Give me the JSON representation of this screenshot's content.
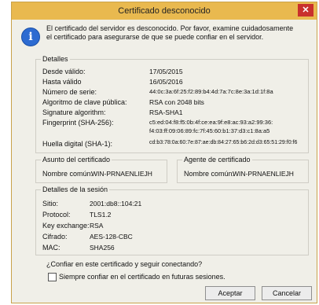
{
  "window": {
    "title": "Certificado desconocido",
    "close_symbol": "✕"
  },
  "intro_text": "El certificado del servidor es desconocido. Por favor, examine cuidadosamente el certificado para asegurarse de que se puede confiar en el servidor.",
  "details": {
    "title": "Detalles",
    "rows": [
      {
        "label": "Desde válido:",
        "value": "17/05/2015"
      },
      {
        "label": "Hasta válido",
        "value": "16/05/2016"
      },
      {
        "label": "Número de serie:",
        "value": "44:0c:3a:6f:25:f2:89:b4:4d:7a:7c:8e:3a:1d:1f:8a"
      },
      {
        "label": "Algoritmo de clave pública:",
        "value": "RSA con 2048 bits"
      },
      {
        "label": "Signature algorithm:",
        "value": "RSA-SHA1"
      },
      {
        "label": "Fingerprint (SHA-256):",
        "value": "c5:ed:04:f8:f5:0b:4f:ce:ea:9f:e8:ac:93:a2:99:36:",
        "value2": "f4:03:ff:09:06:89:fc:7f:45:60:b1:37:d3:c1:8a:a5"
      },
      {
        "label": "Huella digital (SHA-1):",
        "value": "cd:b3:78:0a:60:7e:87:ae:db:84:27:65:b6:2d:d3:65:51:29:f0:f6"
      }
    ]
  },
  "subject": {
    "title": "Asunto del certificado",
    "label": "Nombre común:",
    "value": "WIN-PRNAENLIEJH"
  },
  "issuer": {
    "title": "Agente de certificado",
    "label": "Nombre común:",
    "value": "WIN-PRNAENLIEJH"
  },
  "session": {
    "title": "Detalles de la sesión",
    "rows": [
      {
        "label": "Sitio:",
        "value": "2001:db8::104:21"
      },
      {
        "label": "Protocol:",
        "value": "TLS1.2"
      },
      {
        "label": "Key exchange:",
        "value": "RSA"
      },
      {
        "label": "Cifrado:",
        "value": "AES-128-CBC"
      },
      {
        "label": "MAC:",
        "value": "SHA256"
      }
    ]
  },
  "question": "¿Confiar en este certificado y seguir conectando?",
  "always_trust_label": "Siempre confiar en el certificado en futuras sesiones.",
  "buttons": {
    "accept": "Aceptar",
    "cancel": "Cancelar"
  },
  "colors": {
    "titlebar": "#e9b94f",
    "close": "#c9302c",
    "info_icon": "#2d6bd1"
  },
  "icons": {
    "info": "info-icon",
    "close": "close-icon"
  }
}
